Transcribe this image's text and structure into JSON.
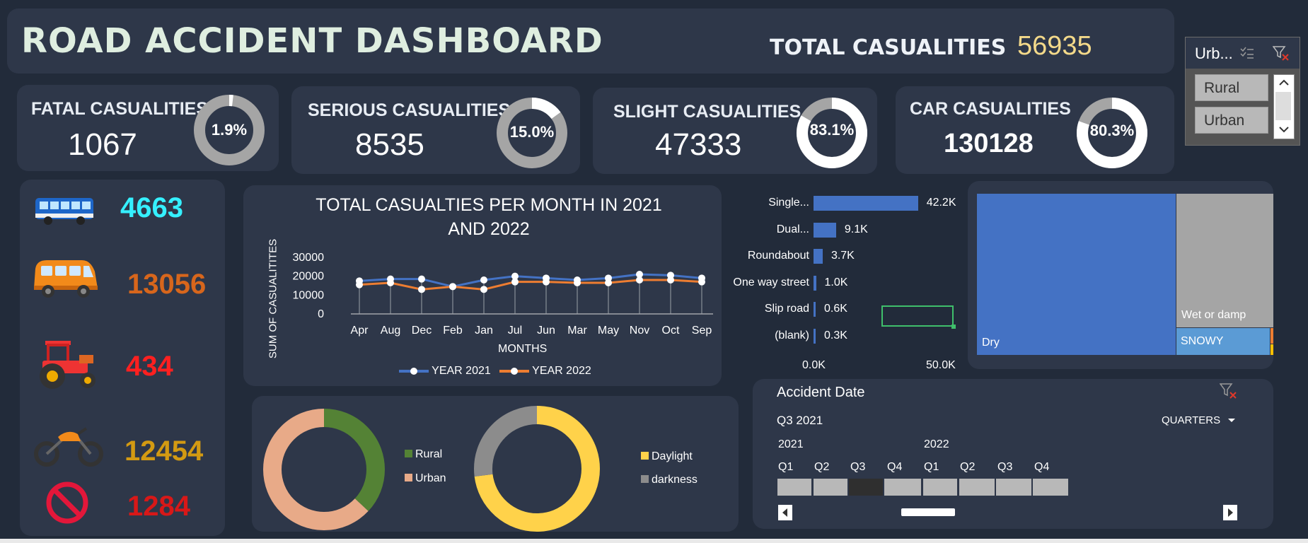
{
  "header": {
    "title": "ROAD ACCIDENT DASHBOARD",
    "total_label": "TOTAL CASUALITIES",
    "total_value": "56935"
  },
  "kpis": [
    {
      "label": "FATAL CASUALITIES",
      "value": "1067",
      "pct": "1.9%",
      "fraction": 0.019
    },
    {
      "label": "SERIOUS CASUALITIES",
      "value": "8535",
      "pct": "15.0%",
      "fraction": 0.15
    },
    {
      "label": "SLIGHT CASUALITIES",
      "value": "47333",
      "pct": "83.1%",
      "fraction": 0.831
    },
    {
      "label": "CAR CASUALITIES",
      "value": "130128",
      "pct": "80.3%",
      "fraction": 0.803
    }
  ],
  "slicer": {
    "title": "Urb...",
    "items": [
      "Rural",
      "Urban"
    ]
  },
  "vehicles": [
    {
      "name": "bus",
      "value": "4663",
      "color": "#35f0ff"
    },
    {
      "name": "van",
      "value": "13056",
      "color": "#d7661c"
    },
    {
      "name": "tractor",
      "value": "434",
      "color": "#ff2020"
    },
    {
      "name": "motorcycle",
      "value": "12454",
      "color": "#d39a12"
    },
    {
      "name": "other",
      "value": "1284",
      "color": "#d81818"
    }
  ],
  "chart_data": [
    {
      "type": "line",
      "title": "TOTAL CASUALTIES PER MONTH IN 2021 AND 2022",
      "title_lines": [
        "TOTAL CASUALTIES PER MONTH IN 2021",
        "AND 2022"
      ],
      "xlabel": "MONTHS",
      "ylabel": "SUM OF CASUALITITES",
      "categories": [
        "Apr",
        "Aug",
        "Dec",
        "Feb",
        "Jan",
        "Jul",
        "Jun",
        "Mar",
        "May",
        "Nov",
        "Oct",
        "Sep"
      ],
      "yticks": [
        "30000",
        "20000",
        "10000",
        "0"
      ],
      "ylim": [
        0,
        30000
      ],
      "series": [
        {
          "name": "YEAR 2021",
          "color": "#4472c4",
          "values": [
            17500,
            18500,
            18500,
            14500,
            18000,
            20000,
            19000,
            18000,
            19000,
            21000,
            20500,
            19000
          ]
        },
        {
          "name": "YEAR 2022",
          "color": "#ed7d31",
          "values": [
            15500,
            16500,
            13000,
            14500,
            13000,
            17000,
            17000,
            16500,
            16500,
            18000,
            18000,
            17000
          ]
        }
      ]
    },
    {
      "type": "bar",
      "orientation": "horizontal",
      "categories": [
        "Single...",
        "Dual...",
        "Roundabout",
        "One way street",
        "Slip road",
        "(blank)"
      ],
      "values": [
        42.2,
        9.1,
        3.7,
        1.0,
        0.6,
        0.3
      ],
      "value_labels": [
        "42.2K",
        "9.1K",
        "3.7K",
        "1.0K",
        "0.6K",
        "0.3K"
      ],
      "xticks": [
        "0.0K",
        "50.0K"
      ],
      "xlim": [
        0,
        50
      ]
    },
    {
      "type": "treemap",
      "items": [
        {
          "name": "Dry",
          "color": "#4472c4"
        },
        {
          "name": "Wet or damp",
          "color": "#a5a5a5"
        },
        {
          "name": "SNOWY",
          "color": "#5b9bd5"
        }
      ]
    },
    {
      "type": "pie",
      "donut": true,
      "legend": [
        "Rural",
        "Urban"
      ],
      "colors": [
        "#548235",
        "#e8aa88"
      ],
      "values": [
        37,
        63
      ]
    },
    {
      "type": "pie",
      "donut": true,
      "legend": [
        "Daylight",
        "darkness"
      ],
      "colors": [
        "#ffd24a",
        "#8c8c8c"
      ],
      "values": [
        73,
        27
      ]
    }
  ],
  "timeline": {
    "title": "Accident Date",
    "selection": "Q3 2021",
    "level": "QUARTERS",
    "years": [
      "2021",
      "2022"
    ],
    "quarters": [
      "Q1",
      "Q2",
      "Q3",
      "Q4",
      "Q1",
      "Q2",
      "Q3",
      "Q4"
    ],
    "selected_index": 2
  }
}
